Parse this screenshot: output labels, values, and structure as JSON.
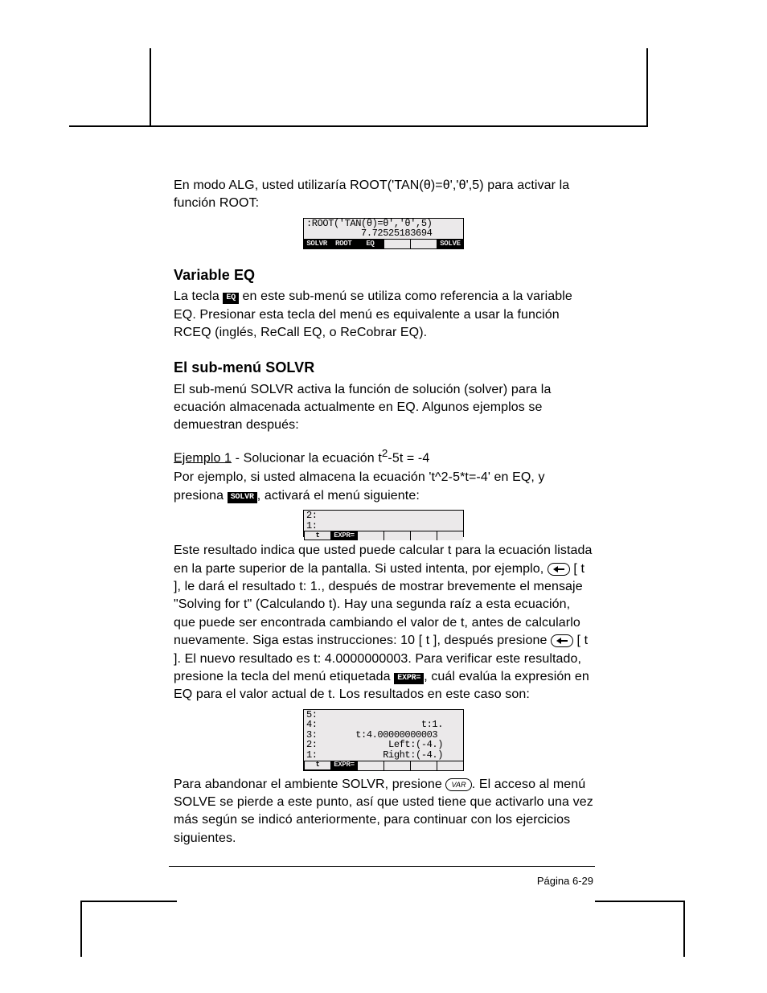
{
  "intro_para": "En modo ALG, usted utilizaría ROOT('TAN(θ)=θ','θ',5) para activar la función ROOT:",
  "screen1": {
    "l1": ":ROOT('TAN(θ)=θ','θ',5)",
    "l2": "          7.72525183694",
    "menu": [
      "SOLVR",
      "ROOT",
      "EQ",
      "",
      "",
      "SOLVE"
    ]
  },
  "h1": "Variable EQ",
  "p1a": "La tecla ",
  "badge_eq": "EQ",
  "p1b": " en este sub-menú se utiliza como referencia a la variable EQ. Presionar esta tecla del menú es equivalente a usar la función RCEQ (inglés, ReCall EQ, o ReCobrar EQ).",
  "h2": "El sub-menú SOLVR",
  "p2": "El sub-menú SOLVR activa la función de solución (solver) para la ecuación almacenada actualmente en EQ.  Algunos ejemplos se demuestran después:",
  "ex_label": "Ejemplo 1",
  "ex_rest_a": " - Solucionar la ecuación t",
  "ex_rest_b": "-5t = -4",
  "p3a": "Por ejemplo, si usted almacena la ecuación 't^2-5*t=-4' en EQ, y presiona ",
  "badge_solvr": "SOLVR",
  "p3b": ", activará el menú siguiente:",
  "screen2": {
    "l1": "2:",
    "l2": "1:",
    "menu": [
      "t",
      "EXPR=",
      "",
      "",
      "",
      ""
    ]
  },
  "p4a": "Este resultado indica que usted puede calcular t para la ecuación listada en la parte superior de la pantalla. Si usted intenta, por ejemplo, ",
  "p4b": "[   t   ], le dará el resultado t: 1., después de mostrar brevemente el mensaje \"Solving for t\" (Calculando t).  Hay una segunda raíz a esta ecuación, que puede ser encontrada cambiando el valor de t, antes de calcularlo nuevamente.  Siga estas instrucciones: 10 [   t   ],  después presione ",
  "p4c": "[  t  ].  El nuevo resultado es t: 4.0000000003.  Para verificar este resultado, presione la tecla del menú etiquetada ",
  "badge_expr": "EXPR=",
  "p4d": ", cuál evalúa la expresión en EQ para el valor actual de t. Los resultados en este caso son:",
  "screen3": {
    "l1": "5:",
    "l2": "4:                   t:1.",
    "l3": "3:       t:4.00000000003",
    "l4": "2:             Left:(-4.)",
    "l5": "1:            Right:(-4.)",
    "menu": [
      "t",
      "EXPR=",
      "",
      "",
      "",
      ""
    ]
  },
  "p5a": "Para abandonar el ambiente SOLVR, presione ",
  "key_var": "VAR",
  "p5b": ".  El acceso al menú SOLVE se pierde a este punto, así que usted tiene que activarlo una vez más según se indicó anteriormente, para continuar con los ejercicios siguientes.",
  "footer": "Página 6-29"
}
